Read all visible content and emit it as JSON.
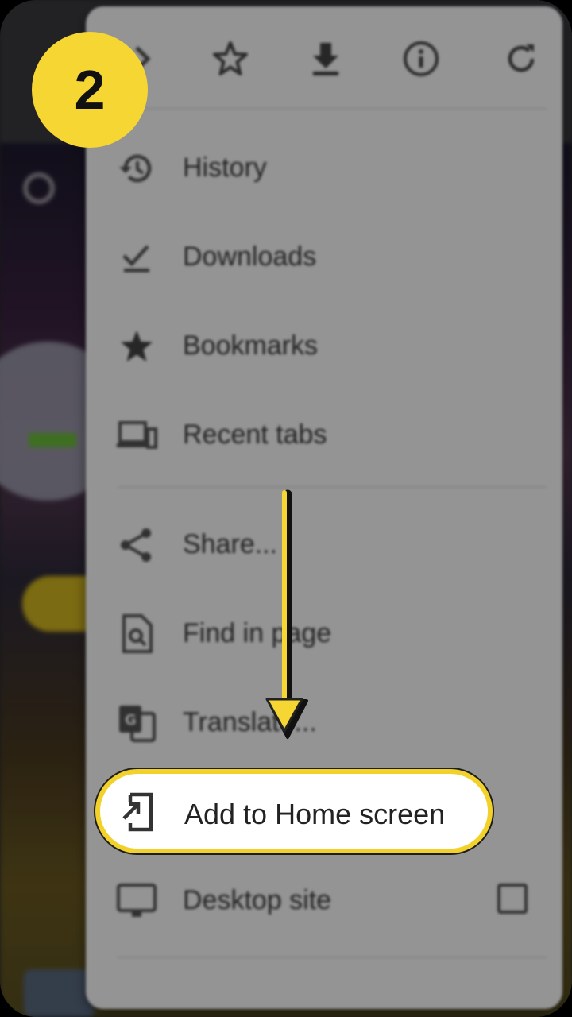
{
  "step": {
    "number": "2"
  },
  "toolbar": {
    "icons": [
      "forward-icon",
      "star-icon",
      "download-icon",
      "info-icon",
      "refresh-icon"
    ]
  },
  "menu": {
    "items": [
      {
        "label": "History",
        "icon": "history-icon"
      },
      {
        "label": "Downloads",
        "icon": "downloads-icon"
      },
      {
        "label": "Bookmarks",
        "icon": "bookmark-star-icon"
      },
      {
        "label": "Recent tabs",
        "icon": "recent-tabs-icon"
      },
      {
        "label": "Share...",
        "icon": "share-icon"
      },
      {
        "label": "Find in page",
        "icon": "find-in-page-icon"
      },
      {
        "label": "Translate...",
        "icon": "translate-icon"
      },
      {
        "label": "Add to Home screen",
        "icon": "add-to-home-icon"
      },
      {
        "label": "Desktop site",
        "icon": "desktop-icon"
      }
    ],
    "highlighted": "Add to Home screen"
  },
  "colors": {
    "accent": "#f6d632",
    "highlight_border": "#f2d22a"
  }
}
